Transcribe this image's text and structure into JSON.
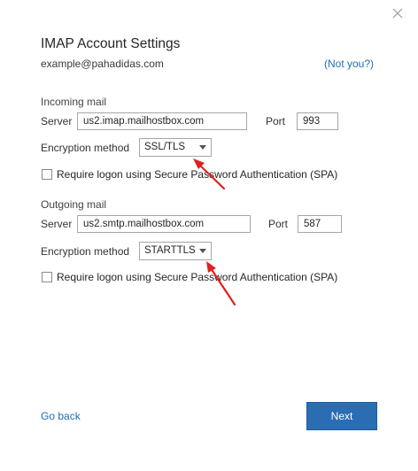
{
  "dialog": {
    "title": "IMAP Account Settings",
    "email": "example@pahadidas.com",
    "not_you_label": "(Not you?)"
  },
  "incoming": {
    "section_label": "Incoming mail",
    "server_label": "Server",
    "server_value": "us2.imap.mailhostbox.com",
    "port_label": "Port",
    "port_value": "993",
    "encryption_label": "Encryption method",
    "encryption_value": "SSL/TLS",
    "spa_label": "Require logon using Secure Password Authentication (SPA)",
    "spa_checked": false
  },
  "outgoing": {
    "section_label": "Outgoing mail",
    "server_label": "Server",
    "server_value": "us2.smtp.mailhostbox.com",
    "port_label": "Port",
    "port_value": "587",
    "encryption_label": "Encryption method",
    "encryption_value": "STARTTLS",
    "spa_label": "Require logon using Secure Password Authentication (SPA)",
    "spa_checked": false
  },
  "footer": {
    "go_back_label": "Go back",
    "next_label": "Next"
  },
  "colors": {
    "accent": "#2b6db3",
    "link": "#1f6fb2",
    "annotation_arrow": "#e02020"
  },
  "icons": {
    "close": "close-icon",
    "dropdown": "chevron-down-icon",
    "annotation": "red-arrow-icon"
  }
}
